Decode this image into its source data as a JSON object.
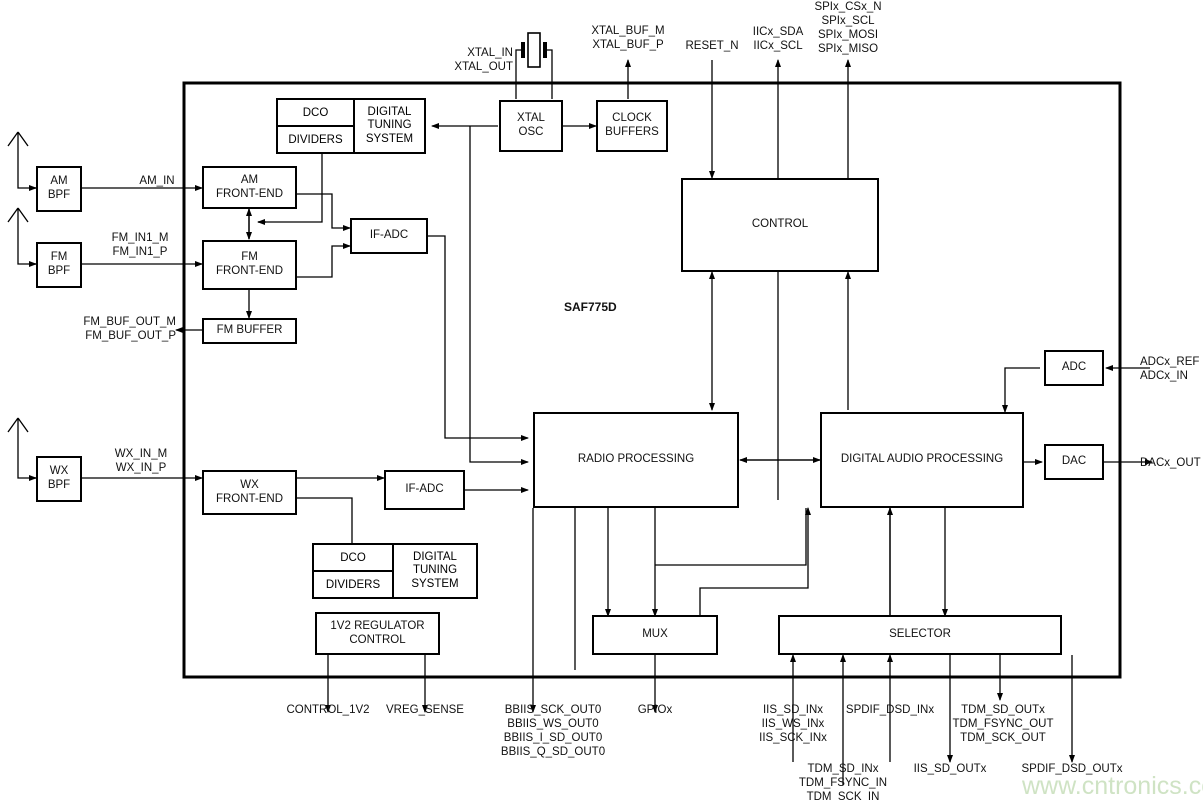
{
  "diagram": {
    "chip_name": "SAF775D",
    "watermark": "www.cntronics.com"
  },
  "blocks": {
    "am_bpf": "AM\nBPF",
    "fm_bpf": "FM\nBPF",
    "wx_bpf": "WX\nBPF",
    "am_frontend": "AM\nFRONT-END",
    "fm_frontend": "FM\nFRONT-END",
    "wx_frontend": "WX\nFRONT-END",
    "fm_buffer": "FM BUFFER",
    "if_adc_top": "IF-ADC",
    "if_adc_bottom": "IF-ADC",
    "dco_top": "DCO",
    "dividers_top": "DIVIDERS",
    "digital_tuning_top": "DIGITAL\nTUNING\nSYSTEM",
    "dco_bottom": "DCO",
    "dividers_bottom": "DIVIDERS",
    "digital_tuning_bottom": "DIGITAL\nTUNING\nSYSTEM",
    "xtal_osc": "XTAL\nOSC",
    "clock_buffers": "CLOCK\nBUFFERS",
    "control": "CONTROL",
    "radio_processing": "RADIO PROCESSING",
    "digital_audio_processing": "DIGITAL AUDIO PROCESSING",
    "adc": "ADC",
    "dac": "DAC",
    "mux": "MUX",
    "selector": "SELECTOR",
    "regulator": "1V2 REGULATOR\nCONTROL"
  },
  "signals": {
    "am_in": "AM_IN",
    "fm_in1": "FM_IN1_M\nFM_IN1_P",
    "wx_in": "WX_IN_M\nWX_IN_P",
    "fm_buf_out": "FM_BUF_OUT_M\nFM_BUF_OUT_P",
    "xtal_in_out": "XTAL_IN\nXTAL_OUT",
    "xtal_buf": "XTAL_BUF_M\nXTAL_BUF_P",
    "reset_n": "RESET_N",
    "iic": "IICx_SDA\nIICx_SCL",
    "spi": "SPIx_CSx_N\nSPIx_SCL\nSPIx_MOSI\nSPIx_MISO",
    "adcx": "ADCx_REF\nADCx_IN",
    "dacx_out": "DACx_OUT",
    "control_1v2": "CONTROL_1V2",
    "vreg_sense": "VREG_SENSE",
    "bbiis": "BBIIS_SCK_OUT0\nBBIIS_WS_OUT0\nBBIIS_I_SD_OUT0\nBBIIS_Q_SD_OUT0",
    "gpiox": "GPIOx",
    "iis_in": "IIS_SD_INx\nIIS_WS_INx\nIIS_SCK_INx",
    "spdif_dsd_in": "SPDIF_DSD_INx",
    "tdm_out": "TDM_SD_OUTx\nTDM_FSYNC_OUT\nTDM_SCK_OUT",
    "tdm_in": "TDM_SD_INx\nTDM_FSYNC_IN\nTDM_SCK_IN",
    "iis_sd_outx": "IIS_SD_OUTx",
    "spdif_dsd_outx": "SPDIF_DSD_OUTx"
  },
  "colors": {
    "line": "#000000",
    "text": "#111111",
    "watermark": "#cfe3c4",
    "background": "#ffffff"
  }
}
